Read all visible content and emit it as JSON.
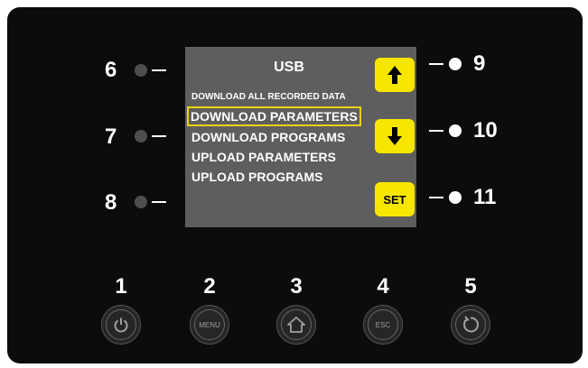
{
  "screen": {
    "title": "USB",
    "menu": [
      "DOWNLOAD ALL RECORDED DATA",
      "DOWNLOAD PARAMETERS",
      "DOWNLOAD PROGRAMS",
      "UPLOAD PARAMETERS",
      "UPLOAD PROGRAMS"
    ],
    "selected_index": 1
  },
  "softkeys": {
    "up": "arrow-up-icon",
    "down": "arrow-down-icon",
    "set_label": "SET"
  },
  "left_labels": [
    "6",
    "7",
    "8"
  ],
  "right_labels": [
    "9",
    "10",
    "11"
  ],
  "hw_buttons": {
    "numbers": [
      "1",
      "2",
      "3",
      "4",
      "5"
    ],
    "menu_label": "MENU",
    "esc_label": "ESC",
    "icons": [
      "power-icon",
      "menu-icon",
      "home-icon",
      "esc-icon",
      "refresh-icon"
    ]
  },
  "colors": {
    "panel": "#0c0c0c",
    "screen": "#5e5e5e",
    "softkey": "#f6e600",
    "selection": "#e8d21a"
  }
}
